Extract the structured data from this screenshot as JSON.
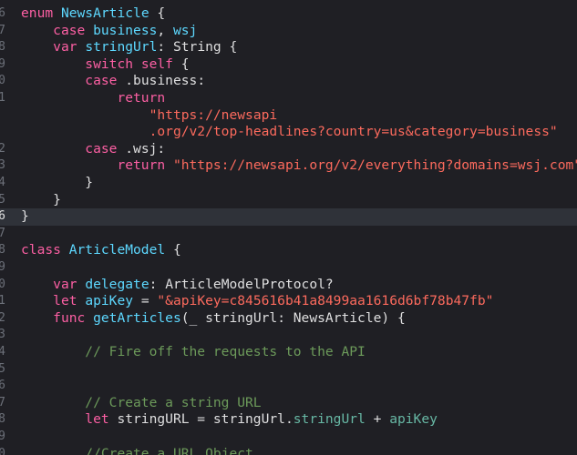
{
  "editor": {
    "current_line": 16,
    "lines": [
      {
        "n": "6",
        "t": [
          {
            "c": "kw",
            "v": "enum"
          },
          {
            "c": "plain",
            "v": " "
          },
          {
            "c": "typedecl",
            "v": "NewsArticle"
          },
          {
            "c": "plain",
            "v": " {"
          }
        ]
      },
      {
        "n": "7",
        "t": [
          {
            "c": "plain",
            "v": "    "
          },
          {
            "c": "kw",
            "v": "case"
          },
          {
            "c": "plain",
            "v": " "
          },
          {
            "c": "typedecl",
            "v": "business"
          },
          {
            "c": "plain",
            "v": ", "
          },
          {
            "c": "typedecl",
            "v": "wsj"
          }
        ]
      },
      {
        "n": "8",
        "t": [
          {
            "c": "plain",
            "v": "    "
          },
          {
            "c": "kw",
            "v": "var"
          },
          {
            "c": "plain",
            "v": " "
          },
          {
            "c": "typedecl",
            "v": "stringUrl"
          },
          {
            "c": "plain",
            "v": ": "
          },
          {
            "c": "plain",
            "v": "String"
          },
          {
            "c": "plain",
            "v": " {"
          }
        ]
      },
      {
        "n": "9",
        "t": [
          {
            "c": "plain",
            "v": "        "
          },
          {
            "c": "kw",
            "v": "switch"
          },
          {
            "c": "plain",
            "v": " "
          },
          {
            "c": "kw",
            "v": "self"
          },
          {
            "c": "plain",
            "v": " {"
          }
        ]
      },
      {
        "n": "0",
        "t": [
          {
            "c": "plain",
            "v": "        "
          },
          {
            "c": "kw",
            "v": "case"
          },
          {
            "c": "plain",
            "v": " ."
          },
          {
            "c": "plain",
            "v": "business"
          },
          {
            "c": "plain",
            "v": ":"
          }
        ]
      },
      {
        "n": "1",
        "t": [
          {
            "c": "plain",
            "v": "            "
          },
          {
            "c": "kw",
            "v": "return"
          }
        ]
      },
      {
        "n": "",
        "t": [
          {
            "c": "plain",
            "v": "                "
          },
          {
            "c": "str",
            "v": "\"https://newsapi"
          }
        ]
      },
      {
        "n": "",
        "t": [
          {
            "c": "plain",
            "v": "                "
          },
          {
            "c": "str",
            "v": ".org/v2/top-headlines?country=us&category=business\""
          }
        ]
      },
      {
        "n": "2",
        "t": [
          {
            "c": "plain",
            "v": "        "
          },
          {
            "c": "kw",
            "v": "case"
          },
          {
            "c": "plain",
            "v": " ."
          },
          {
            "c": "plain",
            "v": "wsj"
          },
          {
            "c": "plain",
            "v": ":"
          }
        ]
      },
      {
        "n": "3",
        "t": [
          {
            "c": "plain",
            "v": "            "
          },
          {
            "c": "kw",
            "v": "return"
          },
          {
            "c": "plain",
            "v": " "
          },
          {
            "c": "str",
            "v": "\"https://newsapi.org/v2/everything?domains=wsj.com\""
          }
        ]
      },
      {
        "n": "4",
        "t": [
          {
            "c": "plain",
            "v": "        }"
          }
        ]
      },
      {
        "n": "5",
        "t": [
          {
            "c": "plain",
            "v": "    }"
          }
        ]
      },
      {
        "n": "6",
        "current": true,
        "t": [
          {
            "c": "plain",
            "v": "}"
          }
        ]
      },
      {
        "n": "7",
        "t": []
      },
      {
        "n": "8",
        "t": [
          {
            "c": "kw",
            "v": "class"
          },
          {
            "c": "plain",
            "v": " "
          },
          {
            "c": "typedecl",
            "v": "ArticleModel"
          },
          {
            "c": "plain",
            "v": " {"
          }
        ]
      },
      {
        "n": "9",
        "t": []
      },
      {
        "n": "0",
        "t": [
          {
            "c": "plain",
            "v": "    "
          },
          {
            "c": "kw",
            "v": "var"
          },
          {
            "c": "plain",
            "v": " "
          },
          {
            "c": "typedecl",
            "v": "delegate"
          },
          {
            "c": "plain",
            "v": ": "
          },
          {
            "c": "plain",
            "v": "ArticleModelProtocol?"
          }
        ]
      },
      {
        "n": "1",
        "t": [
          {
            "c": "plain",
            "v": "    "
          },
          {
            "c": "kw",
            "v": "let"
          },
          {
            "c": "plain",
            "v": " "
          },
          {
            "c": "typedecl",
            "v": "apiKey"
          },
          {
            "c": "plain",
            "v": " = "
          },
          {
            "c": "str",
            "v": "\"&apiKey=c845616b41a8499aa1616d6bf78b47fb\""
          }
        ]
      },
      {
        "n": "2",
        "t": [
          {
            "c": "plain",
            "v": "    "
          },
          {
            "c": "kw",
            "v": "func"
          },
          {
            "c": "plain",
            "v": " "
          },
          {
            "c": "typedecl",
            "v": "getArticles"
          },
          {
            "c": "plain",
            "v": "(_ stringUrl: NewsArticle) {"
          }
        ]
      },
      {
        "n": "3",
        "t": []
      },
      {
        "n": "4",
        "t": [
          {
            "c": "plain",
            "v": "        "
          },
          {
            "c": "cmt",
            "v": "// Fire off the requests to the API"
          }
        ]
      },
      {
        "n": "5",
        "t": []
      },
      {
        "n": "6",
        "t": []
      },
      {
        "n": "7",
        "t": [
          {
            "c": "plain",
            "v": "        "
          },
          {
            "c": "cmt",
            "v": "// Create a string URL"
          }
        ]
      },
      {
        "n": "8",
        "t": [
          {
            "c": "plain",
            "v": "        "
          },
          {
            "c": "kw",
            "v": "let"
          },
          {
            "c": "plain",
            "v": " stringURL = stringUrl."
          },
          {
            "c": "member",
            "v": "stringUrl"
          },
          {
            "c": "plain",
            "v": " + "
          },
          {
            "c": "member",
            "v": "apiKey"
          }
        ]
      },
      {
        "n": "9",
        "t": []
      },
      {
        "n": "0",
        "t": [
          {
            "c": "plain",
            "v": "        "
          },
          {
            "c": "cmt",
            "v": "//Create a URL Object"
          }
        ]
      }
    ]
  }
}
